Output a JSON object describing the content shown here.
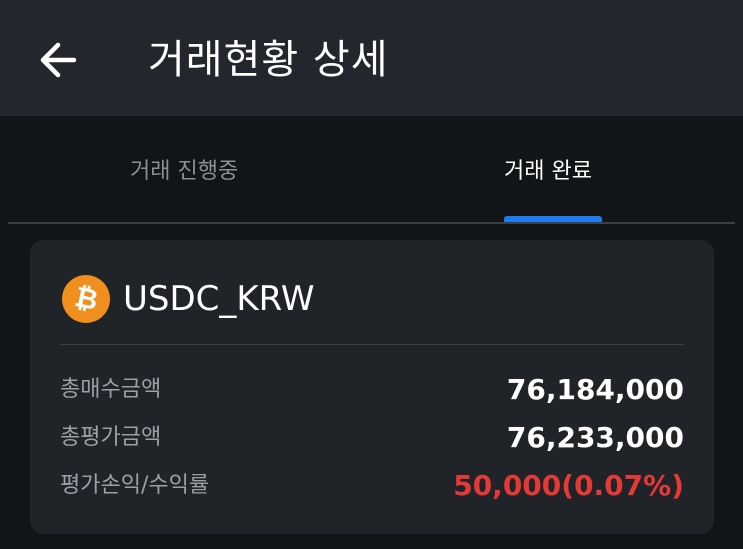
{
  "header": {
    "title": "거래현황 상세",
    "back_icon": "back-arrow-icon"
  },
  "tabs": [
    {
      "label": "거래 진행중",
      "active": false
    },
    {
      "label": "거래 완료",
      "active": true
    }
  ],
  "colors": {
    "accent": "#1e7cf0",
    "loss": "#e53935",
    "coin": "#f08f1e"
  },
  "card": {
    "coin_icon": "bitcoin-icon",
    "coin_symbol": "₿",
    "pair": "USDC_KRW",
    "rows": [
      {
        "label": "총매수금액",
        "value": "76,184,000"
      },
      {
        "label": "총평가금액",
        "value": "76,233,000"
      },
      {
        "label": "평가손익/수익률",
        "value": "50,000(0.07%)"
      }
    ]
  }
}
